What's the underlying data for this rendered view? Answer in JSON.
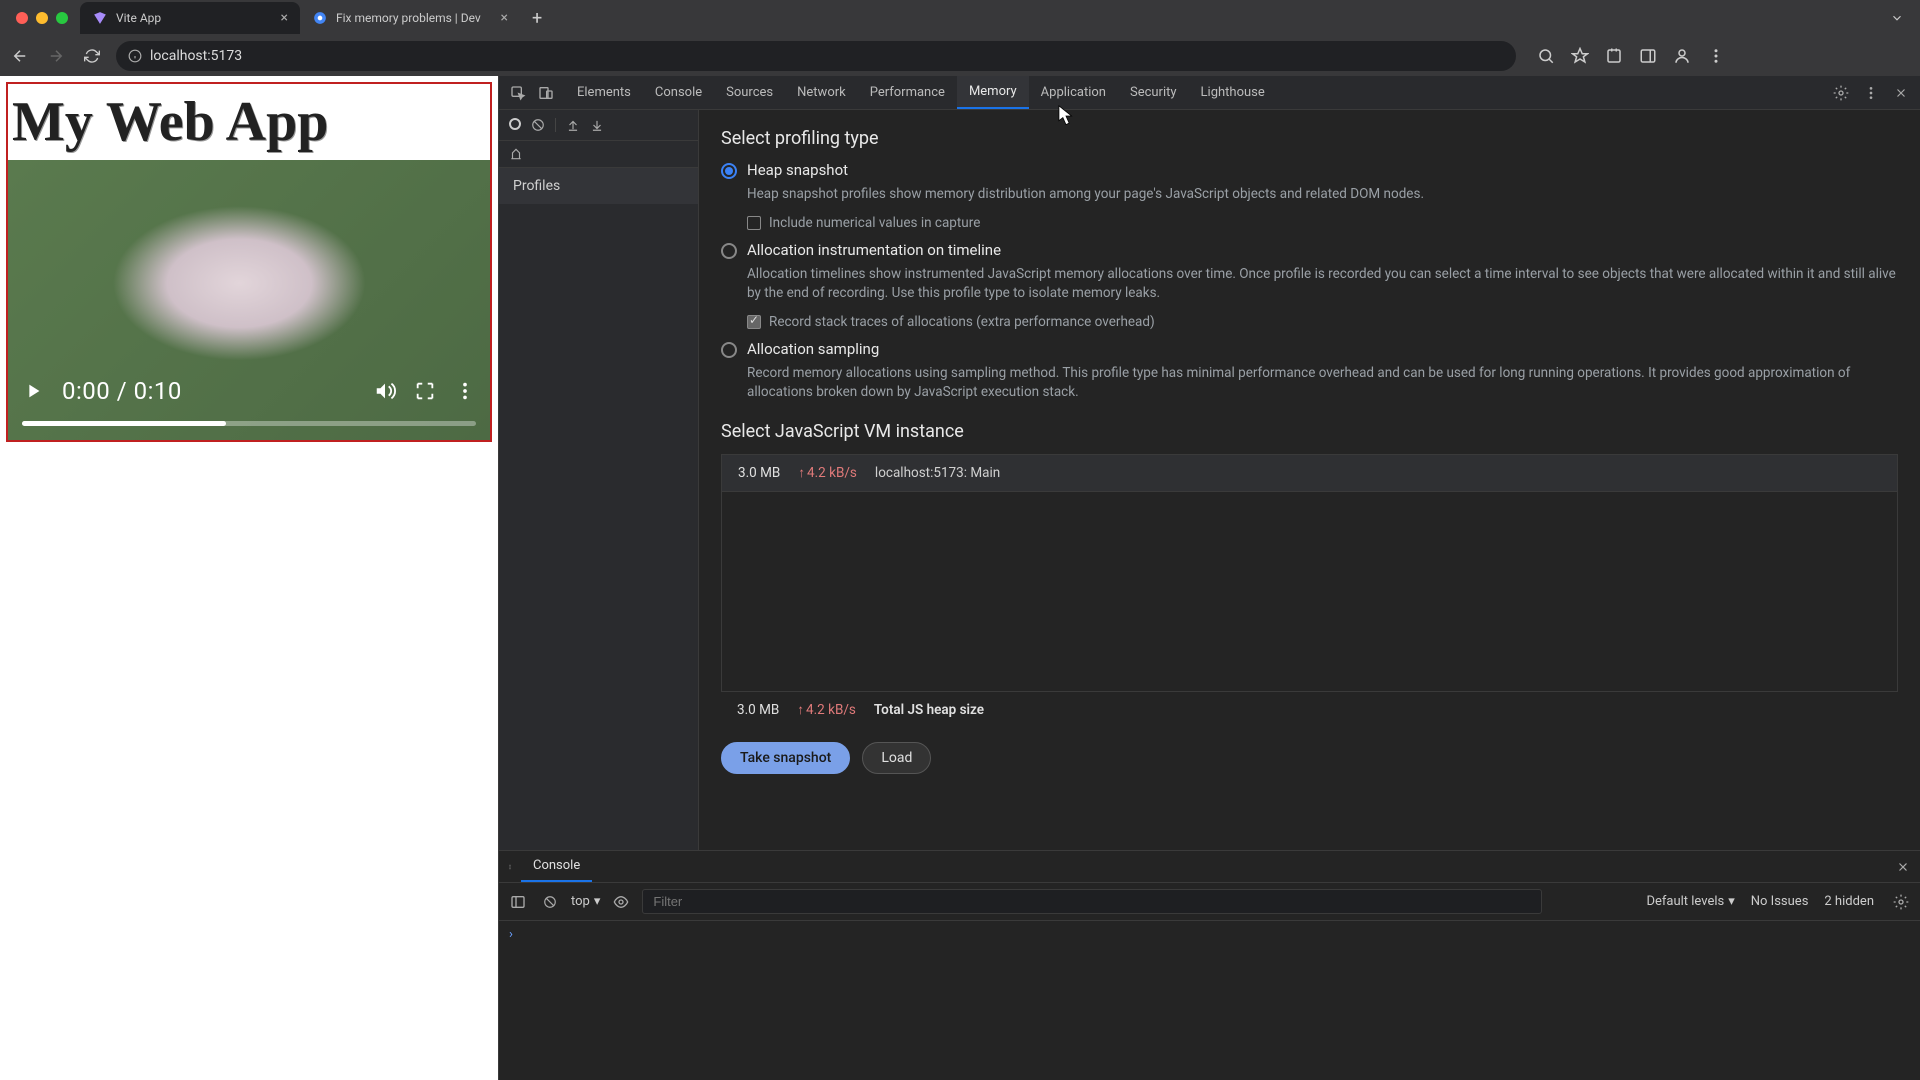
{
  "browser": {
    "tabs": [
      {
        "title": "Vite App",
        "favicon": "vite"
      },
      {
        "title": "Fix memory problems  |  Dev",
        "favicon": "chrome"
      }
    ],
    "url": "localhost:5173"
  },
  "page": {
    "heading": "My Web App",
    "video": {
      "time": "0:00 / 0:10"
    }
  },
  "devtools": {
    "tabs": [
      "Elements",
      "Console",
      "Sources",
      "Network",
      "Performance",
      "Memory",
      "Application",
      "Security",
      "Lighthouse"
    ],
    "activeTab": "Memory",
    "sidebar": {
      "section": "Profiles"
    },
    "memory": {
      "sectProfiling": "Select profiling type",
      "opts": [
        {
          "label": "Heap snapshot",
          "desc": "Heap snapshot profiles show memory distribution among your page's JavaScript objects and related DOM nodes.",
          "checked": true,
          "sub": {
            "label": "Include numerical values in capture",
            "checked": false
          }
        },
        {
          "label": "Allocation instrumentation on timeline",
          "desc": "Allocation timelines show instrumented JavaScript memory allocations over time. Once profile is recorded you can select a time interval to see objects that were allocated within it and still alive by the end of recording. Use this profile type to isolate memory leaks.",
          "checked": false,
          "sub": {
            "label": "Record stack traces of allocations (extra performance overhead)",
            "checked": true
          }
        },
        {
          "label": "Allocation sampling",
          "desc": "Record memory allocations using sampling method. This profile type has minimal performance overhead and can be used for long running operations. It provides good approximation of allocations broken down by JavaScript execution stack.",
          "checked": false
        }
      ],
      "sectVM": "Select JavaScript VM instance",
      "vm": {
        "size": "3.0 MB",
        "rate": "4.2 kB/s",
        "name": "localhost:5173: Main"
      },
      "summary": {
        "size": "3.0 MB",
        "rate": "4.2 kB/s",
        "label": "Total JS heap size"
      },
      "buttons": {
        "primary": "Take snapshot",
        "secondary": "Load"
      }
    }
  },
  "console": {
    "tab": "Console",
    "context": "top",
    "filterPlaceholder": "Filter",
    "levels": "Default levels",
    "issues": "No Issues",
    "hidden": "2 hidden"
  }
}
